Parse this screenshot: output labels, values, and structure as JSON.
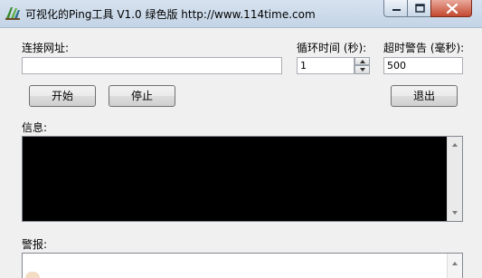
{
  "window": {
    "title": "可视化的Ping工具 V1.0 绿色版  http://www.114time.com",
    "icon": "app-ping-icon",
    "controls": [
      "minimize-icon",
      "maximize-icon",
      "close-icon"
    ]
  },
  "form": {
    "url_label": "连接网址:",
    "url_value": "",
    "interval_label": "循环时间 (秒):",
    "interval_value": "1",
    "timeout_label": "超时警告 (毫秒):",
    "timeout_value": "500"
  },
  "buttons": {
    "start": "开始",
    "stop": "停止",
    "exit": "退出"
  },
  "info": {
    "label": "信息:"
  },
  "alert": {
    "label": "警报:"
  }
}
